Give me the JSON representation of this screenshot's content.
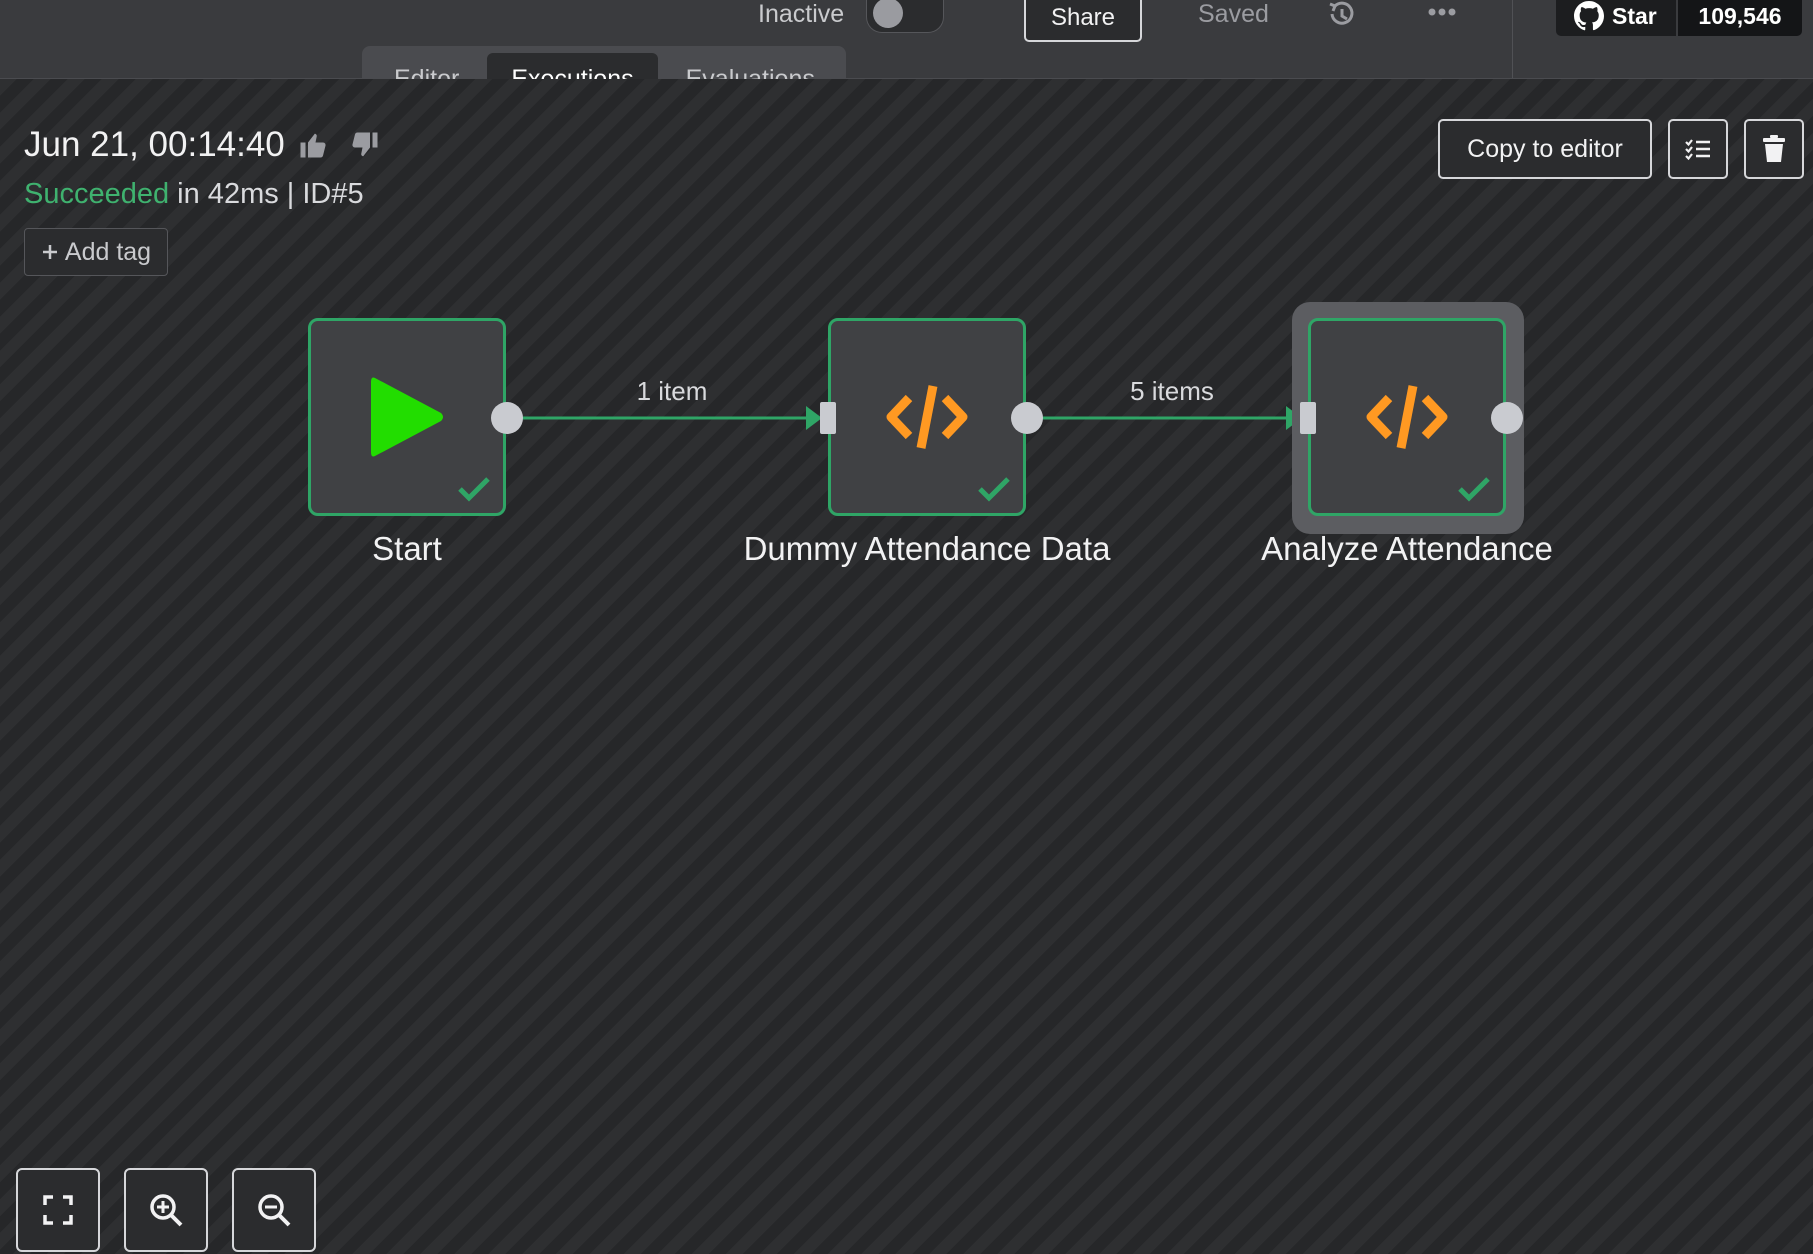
{
  "header": {
    "status_label": "Inactive",
    "share_label": "Share",
    "saved_label": "Saved",
    "github": {
      "star_label": "Star",
      "count": "109,546"
    },
    "tabs": [
      {
        "label": "Editor",
        "active": false
      },
      {
        "label": "Executions",
        "active": true
      },
      {
        "label": "Evaluations",
        "active": false
      }
    ]
  },
  "execution": {
    "date": "Jun 21, 00:14:40",
    "status": "Succeeded",
    "duration_text": " in 42ms | ID#5",
    "add_tag_label": "Add tag",
    "copy_label": "Copy to editor"
  },
  "workflow": {
    "nodes": [
      {
        "label": "Start",
        "icon": "play-icon",
        "status": "success"
      },
      {
        "label": "Dummy Attendance Data",
        "icon": "code-icon",
        "status": "success"
      },
      {
        "label": "Analyze Attendance",
        "icon": "code-icon",
        "status": "success",
        "selected": true
      }
    ],
    "edges": [
      {
        "label": "1 item"
      },
      {
        "label": "5 items"
      }
    ]
  },
  "colors": {
    "success": "#2fa566",
    "play": "#22dd00",
    "code": "#ff9922",
    "status_ok": "#3fb26f"
  }
}
